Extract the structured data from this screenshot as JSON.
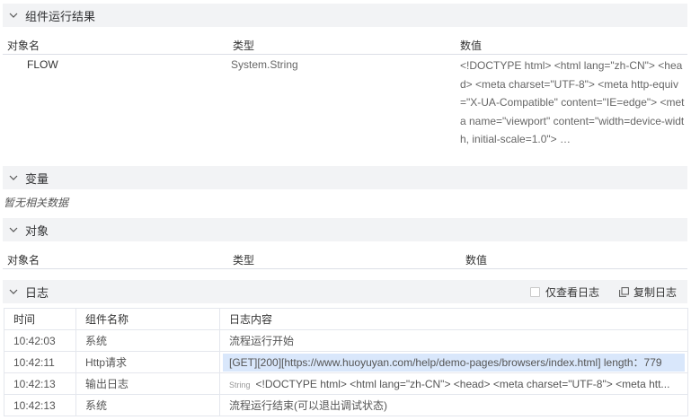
{
  "result_section": {
    "title": "组件运行结果",
    "columns": [
      "对象名",
      "类型",
      "数值"
    ],
    "row": {
      "name": "FLOW",
      "type": "System.String",
      "value": "<!DOCTYPE html> <html lang=\"zh-CN\"> <head> <meta charset=\"UTF-8\"> <meta http-equiv=\"X-UA-Compatible\" content=\"IE=edge\"> <meta name=\"viewport\" content=\"width=device-width, initial-scale=1.0\"> …"
    }
  },
  "variables_section": {
    "title": "变量",
    "empty_text": "暂无相关数据"
  },
  "objects_section": {
    "title": "对象",
    "columns": [
      "对象名",
      "类型",
      "数值"
    ]
  },
  "log_section": {
    "title": "日志",
    "only_view_log": "仅查看日志",
    "copy_log": "复制日志",
    "columns": [
      "时间",
      "组件名称",
      "日志内容"
    ],
    "rows": [
      {
        "time": "10:42:03",
        "component": "系统",
        "content": "流程运行开始"
      },
      {
        "time": "10:42:11",
        "component": "Http请求",
        "content": "[GET][200][https://www.huoyuyan.com/help/demo-pages/browsers/index.html] length：779"
      },
      {
        "time": "10:42:13",
        "component": "输出日志",
        "tag": "String",
        "content": "<!DOCTYPE html> <html lang=\"zh-CN\"> <head> <meta charset=\"UTF-8\"> <meta htt..."
      },
      {
        "time": "10:42:13",
        "component": "系统",
        "content": "流程运行结束(可以退出调试状态)"
      }
    ]
  },
  "icons": {
    "chevron": "chevron-down-icon",
    "copy": "copy-icon"
  }
}
